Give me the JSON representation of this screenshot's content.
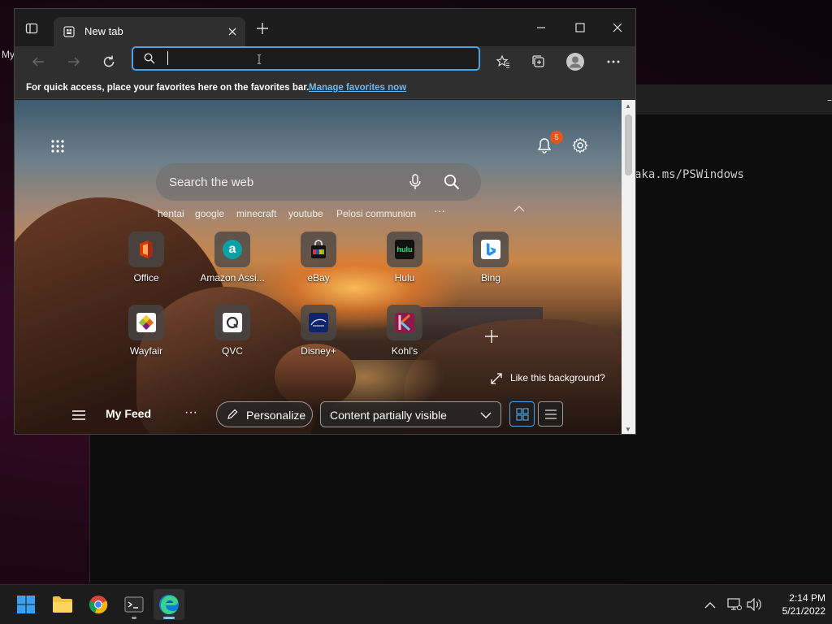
{
  "desktop": {
    "label": "My"
  },
  "terminal": {
    "text": "aka.ms/PSWindows",
    "tab_edge": "–"
  },
  "browser": {
    "tab_title": "New tab",
    "new_tab_symbol": "+",
    "address_value": "",
    "favorites_bar": {
      "text": "For quick access, place your favorites here on the favorites bar.",
      "link": "Manage favorites now"
    }
  },
  "ntp": {
    "notification_count": "5",
    "search_placeholder": "Search the web",
    "trending": [
      "hentai",
      "google",
      "minecraft",
      "youtube",
      "Pelosi communion"
    ],
    "trending_more": "···",
    "quick_links": [
      {
        "label": "Office",
        "color": "#d83b01"
      },
      {
        "label": "Amazon Assi...",
        "color": "#00a8a8"
      },
      {
        "label": "eBay",
        "color": "#e53238"
      },
      {
        "label": "Hulu",
        "color": "#1ce783"
      },
      {
        "label": "Bing",
        "color": "#258ffa"
      },
      {
        "label": "Wayfair",
        "color": "#7f187f"
      },
      {
        "label": "QVC",
        "color": "#ffffff"
      },
      {
        "label": "Disney+",
        "color": "#113ccf"
      },
      {
        "label": "Kohl's",
        "color": "#8b1a4a"
      }
    ],
    "add_tile_symbol": "+",
    "like_background": "Like this background?",
    "feed": {
      "title": "My Feed",
      "more": "···",
      "personalize": "Personalize",
      "visibility": "Content partially visible"
    }
  },
  "taskbar": {
    "time": "2:14 PM",
    "date": "5/21/2022"
  },
  "colors": {
    "accent": "#4aa3e6",
    "badge": "#e8541a",
    "link": "#6cb7f2"
  }
}
